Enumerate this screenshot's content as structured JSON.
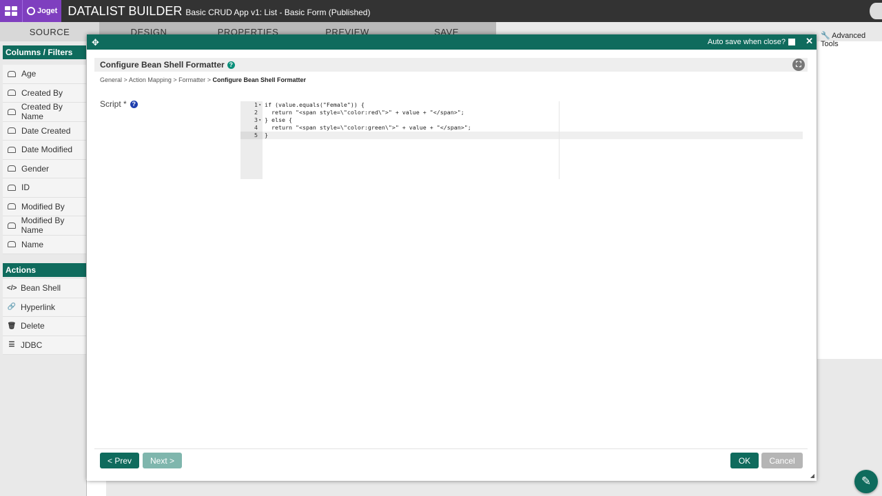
{
  "header": {
    "logo_text": "Joget",
    "builder_title": "DATALIST BUILDER",
    "app_subtitle": "Basic CRUD App v1: List - Basic Form (Published)"
  },
  "tabs": [
    {
      "label": "SOURCE"
    },
    {
      "label": "DESIGN"
    },
    {
      "label": "PROPERTIES"
    },
    {
      "label": "PREVIEW"
    },
    {
      "label": "SAVE"
    }
  ],
  "tools": {
    "advanced_label": "Advanced Tools"
  },
  "sidebar": {
    "columns_header": "Columns / Filters",
    "columns": [
      "Age",
      "Created By",
      "Created By Name",
      "Date Created",
      "Date Modified",
      "Gender",
      "ID",
      "Modified By",
      "Modified By Name",
      "Name"
    ],
    "actions_header": "Actions",
    "actions": [
      {
        "label": "Bean Shell",
        "icon": "code-icon"
      },
      {
        "label": "Hyperlink",
        "icon": "link-icon"
      },
      {
        "label": "Delete",
        "icon": "trash-icon"
      },
      {
        "label": "JDBC",
        "icon": "database-icon"
      }
    ]
  },
  "dialog": {
    "autosave_label": "Auto save when close?",
    "autosave_checked": false,
    "title": "Configure Bean Shell Formatter",
    "breadcrumb": {
      "items": [
        "General",
        "Action Mapping",
        "Formatter"
      ],
      "current": "Configure Bean Shell Formatter",
      "separator": ">"
    },
    "script_label": "Script *",
    "code_lines": [
      "if (value.equals(\"Female\")) {",
      "  return \"<span style=\\\"color:red\\\">\" + value + \"</span>\";",
      "} else {",
      "  return \"<span style=\\\"color:green\\\">\" + value + \"</span>\";",
      "}"
    ],
    "line_numbers": [
      "1",
      "2",
      "3",
      "4",
      "5"
    ],
    "buttons": {
      "prev": "< Prev",
      "next": "Next >",
      "ok": "OK",
      "cancel": "Cancel"
    }
  },
  "colors": {
    "primary": "#0f6b5d",
    "brand": "#7f3fbf",
    "topbar": "#333333"
  }
}
